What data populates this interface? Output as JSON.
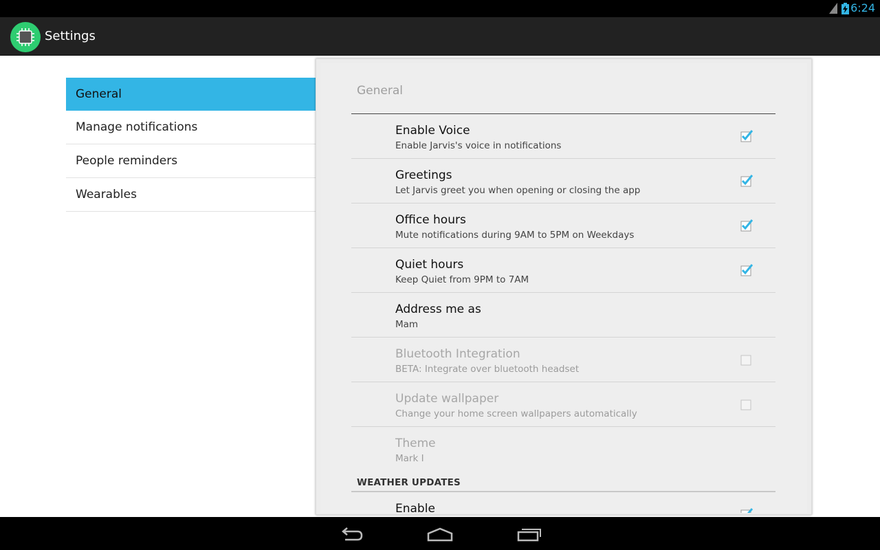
{
  "status_bar": {
    "time": "6:24",
    "icons": [
      "signal-icon",
      "battery-charging-icon"
    ]
  },
  "action_bar": {
    "title": "Settings",
    "icon": "chip-icon"
  },
  "headers": [
    {
      "label": "General",
      "selected": true
    },
    {
      "label": "Manage notifications",
      "selected": false
    },
    {
      "label": "People reminders",
      "selected": false
    },
    {
      "label": "Wearables",
      "selected": false
    }
  ],
  "panel": {
    "breadcrumb": "General",
    "preferences": [
      {
        "title": "Enable Voice",
        "summary": "Enable Jarvis's voice in notifications",
        "checkbox": true,
        "checked": true,
        "enabled": true
      },
      {
        "title": "Greetings",
        "summary": "Let Jarvis greet you when opening or closing the app",
        "checkbox": true,
        "checked": true,
        "enabled": true
      },
      {
        "title": "Office hours",
        "summary": "Mute notifications during 9AM to 5PM on Weekdays",
        "checkbox": true,
        "checked": true,
        "enabled": true
      },
      {
        "title": "Quiet hours",
        "summary": "Keep Quiet from 9PM to 7AM",
        "checkbox": true,
        "checked": true,
        "enabled": true
      },
      {
        "title": "Address me as",
        "summary": "Mam",
        "checkbox": false,
        "enabled": true
      },
      {
        "title": "Bluetooth Integration",
        "summary": "BETA: Integrate over bluetooth headset",
        "checkbox": true,
        "checked": false,
        "enabled": false
      },
      {
        "title": "Update wallpaper",
        "summary": "Change your home screen wallpapers automatically",
        "checkbox": true,
        "checked": false,
        "enabled": false
      },
      {
        "title": "Theme",
        "summary": "Mark I",
        "checkbox": false,
        "enabled": false
      }
    ],
    "category": "WEATHER UPDATES",
    "category_preferences": [
      {
        "title": "Enable",
        "summary": "",
        "checkbox": true,
        "checked": true,
        "enabled": true
      }
    ]
  },
  "nav_bar": {
    "buttons": [
      "back-icon",
      "home-icon",
      "recents-icon"
    ]
  },
  "colors": {
    "accent": "#33b5e5",
    "action_bar": "#222222",
    "app_icon": "#2ecc71"
  }
}
